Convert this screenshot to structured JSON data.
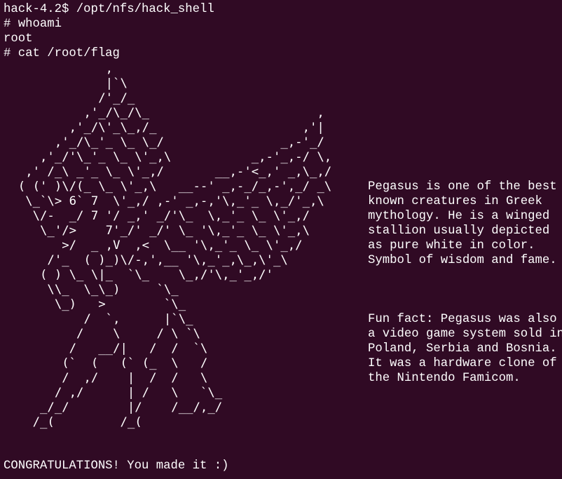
{
  "terminal": {
    "prompt_command": "hack-4.2$ /opt/nfs/hack_shell",
    "whoami_command": "# whoami",
    "whoami_output": "root",
    "cat_command": "# cat /root/flag",
    "ascii_art": "              ,\n              |`\\\n             /'_/_\n           ,'_/\\_/\\_                       ,\n         ,'_/\\'_\\_,/_                    ,'|\n       ,'_/\\_'_ \\_ \\_/                _,-'_/\n     ,'_/'\\_'_ \\_ \\'_,\\           _,-'_,-/ \\,\n   ,' /_\\ _'_ \\_ \\'_,/       __,-'<_,' _,\\_,/\n  ( (' )\\/(_ \\_ \\'_,\\   __--' _,-_/_,-',_/ _\\\n   \\_`\\> 6` 7  \\'_,/ ,-' _,-,'\\,_'_ \\,_/'_,\\\n    \\/-  _/ 7 '/ _,' _/'\\_  \\,_'_ \\_ \\'_,/\n     \\_'/>    7'_/' _/' \\_ '\\,_'_ \\_ \\'_,\\\n        >/  _ ,V  ,<  \\__ '\\,_'_ \\_ \\'_,/\n      /'_  ( )_)\\/-,',__ '\\,_'_,\\_,\\'_\\\n     ( ) \\_ \\|_  `\\_    \\_,/'\\,_'_,/'\n      \\\\_  \\_\\_)     `\\_\n       \\_)   >        `\\_\n           /  `,      |`\\_\n          /    \\     / \\ `\\\n         /   __/|   /  /  `\\\n        (`  (   (` (_  \\   /\n        /  ,/    |  /  /   \\\n       / ,/      | /   \\   `\\_\n     _/_/        |/    /__/,_/\n    /_(         /_(",
    "description": "Pegasus is one of the best\nknown creatures in Greek\nmythology. He is a winged\nstallion usually depicted\nas pure white in color.\nSymbol of wisdom and fame.",
    "fun_fact": "Fun fact: Pegasus was also\na video game system sold in\nPoland, Serbia and Bosnia.\nIt was a hardware clone of\nthe Nintendo Famicom.",
    "congratulations": "CONGRATULATIONS! You made it :)"
  },
  "colors": {
    "background": "#300a24",
    "text": "#ffffff"
  }
}
